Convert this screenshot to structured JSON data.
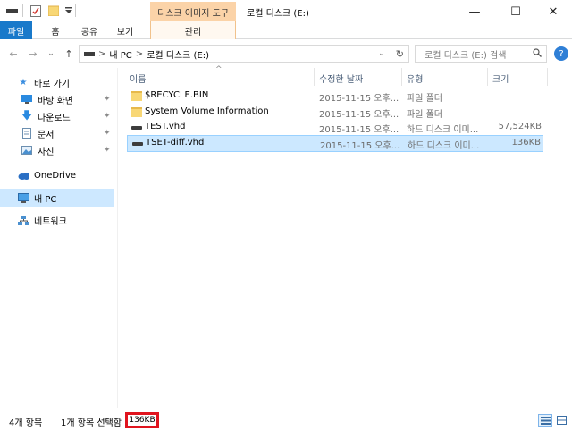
{
  "window": {
    "title": "로컬 디스크 (E:)",
    "context_tool_label": "디스크 이미지 도구",
    "minimize": "—",
    "maximize": "☐",
    "close": "✕"
  },
  "ribbon": {
    "tabs": [
      "파일",
      "홈",
      "공유",
      "보기"
    ],
    "manage_label": "관리"
  },
  "nav": {
    "back": "←",
    "forward": "→",
    "recent": "⌄",
    "up": "↑",
    "breadcrumb": [
      "내 PC",
      "로컬 디스크 (E:)"
    ],
    "separator": ">",
    "search_placeholder": "로컬 디스크 (E:) 검색",
    "help": "?"
  },
  "navpane": {
    "quick_access": "바로 가기",
    "items": [
      {
        "label": "바탕 화면",
        "icon": "desktop-icon",
        "pinned": true
      },
      {
        "label": "다운로드",
        "icon": "download-icon",
        "pinned": true
      },
      {
        "label": "문서",
        "icon": "documents-icon",
        "pinned": true
      },
      {
        "label": "사진",
        "icon": "pictures-icon",
        "pinned": true
      }
    ],
    "onedrive": "OneDrive",
    "thispc": "내 PC",
    "network": "네트워크",
    "pin_glyph": "📌"
  },
  "columns": {
    "name": "이름",
    "modified": "수정한 날짜",
    "type": "유형",
    "size": "크기"
  },
  "files": [
    {
      "name": "$RECYCLE.BIN",
      "date": "2015-11-15 오후...",
      "type": "파일 폴더",
      "size": "",
      "icon": "folder-icon"
    },
    {
      "name": "System Volume Information",
      "date": "2015-11-15 오후...",
      "type": "파일 폴더",
      "size": "",
      "icon": "folder-icon"
    },
    {
      "name": "TEST.vhd",
      "date": "2015-11-15 오후...",
      "type": "하드 디스크 이미...",
      "size": "57,524KB",
      "icon": "vhd-icon"
    },
    {
      "name": "TSET-diff.vhd",
      "date": "2015-11-15 오후...",
      "type": "하드 디스크 이미...",
      "size": "136KB",
      "icon": "vhd-icon",
      "selected": true
    }
  ],
  "status": {
    "item_count": "4개 항목",
    "selected": "1개 항목 선택함",
    "selected_size": "136KB"
  },
  "colors": {
    "file_tab": "#1979ca",
    "context_tab": "#fbd3a8",
    "selection": "#cce8ff",
    "highlight_box": "#e0141e"
  }
}
